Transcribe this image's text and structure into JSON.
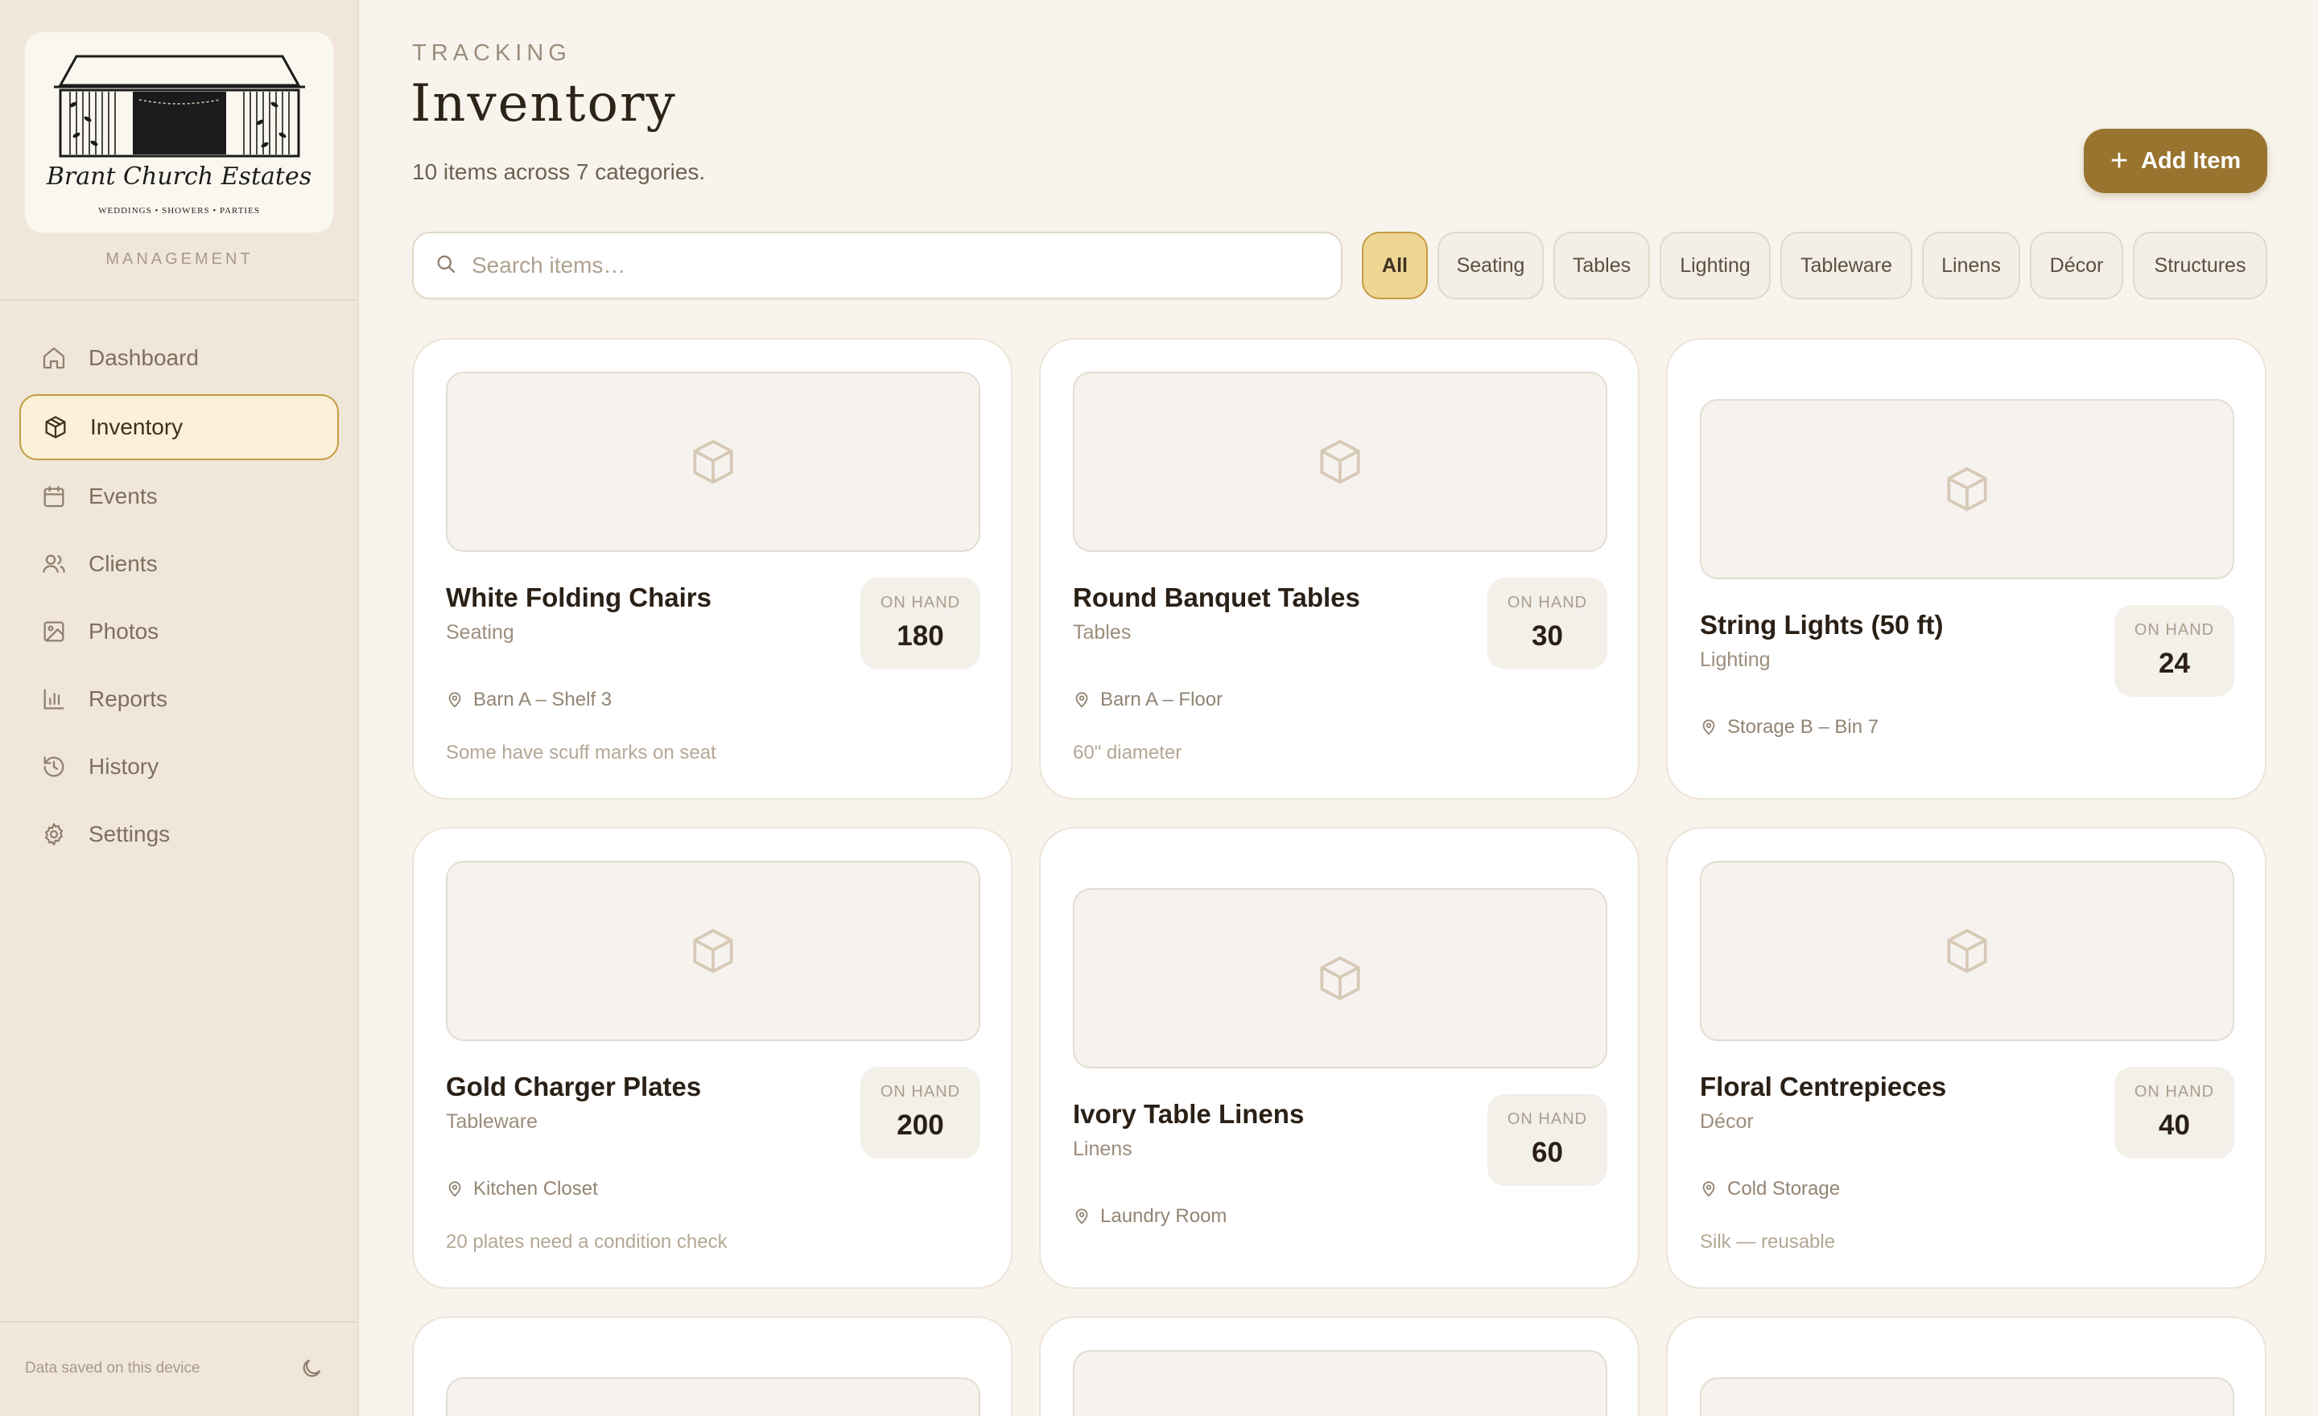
{
  "brand": {
    "name": "Brant Church Estates",
    "tagline": "WEDDINGS • SHOWERS • PARTIES",
    "section": "MANAGEMENT"
  },
  "nav": {
    "items": [
      {
        "label": "Dashboard",
        "icon": "home-icon",
        "active": false
      },
      {
        "label": "Inventory",
        "icon": "package-icon",
        "active": true
      },
      {
        "label": "Events",
        "icon": "calendar-icon",
        "active": false
      },
      {
        "label": "Clients",
        "icon": "users-icon",
        "active": false
      },
      {
        "label": "Photos",
        "icon": "image-icon",
        "active": false
      },
      {
        "label": "Reports",
        "icon": "bar-chart-icon",
        "active": false
      },
      {
        "label": "History",
        "icon": "history-icon",
        "active": false
      },
      {
        "label": "Settings",
        "icon": "gear-icon",
        "active": false
      }
    ]
  },
  "footer": {
    "status": "Data saved on this device",
    "theme_icon": "moon-icon"
  },
  "header": {
    "eyebrow": "TRACKING",
    "title": "Inventory",
    "summary": "10 items across 7 categories.",
    "add_label": "Add Item"
  },
  "search": {
    "placeholder": "Search items…",
    "value": ""
  },
  "filters": [
    "All",
    "Seating",
    "Tables",
    "Lighting",
    "Tableware",
    "Linens",
    "Décor",
    "Structures"
  ],
  "active_filter": "All",
  "on_hand_label": "ON HAND",
  "items": [
    {
      "name": "White Folding Chairs",
      "category": "Seating",
      "qty": "180",
      "location": "Barn A – Shelf 3",
      "note": "Some have scuff marks on seat"
    },
    {
      "name": "Round Banquet Tables",
      "category": "Tables",
      "qty": "30",
      "location": "Barn A – Floor",
      "note": "60\" diameter"
    },
    {
      "name": "String Lights (50 ft)",
      "category": "Lighting",
      "qty": "24",
      "location": "Storage B – Bin 7",
      "note": ""
    },
    {
      "name": "Gold Charger Plates",
      "category": "Tableware",
      "qty": "200",
      "location": "Kitchen Closet",
      "note": "20 plates need a condition check"
    },
    {
      "name": "Ivory Table Linens",
      "category": "Linens",
      "qty": "60",
      "location": "Laundry Room",
      "note": ""
    },
    {
      "name": "Floral Centrepieces",
      "category": "Décor",
      "qty": "40",
      "location": "Cold Storage",
      "note": "Silk — reusable"
    }
  ],
  "colors": {
    "accent": "#98742f",
    "active_chip": "#efd695",
    "sidebar": "#f0e7da",
    "background": "#f8f4ed"
  }
}
